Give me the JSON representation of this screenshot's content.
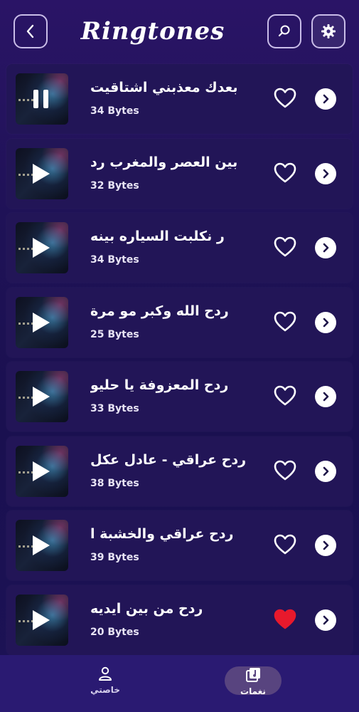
{
  "header": {
    "title": "Ringtones",
    "back_icon": "chevron-left-icon",
    "search_icon": "search-icon",
    "settings_icon": "gear-icon"
  },
  "ringtones": [
    {
      "name": "بعدك معذبني اشتاقيت",
      "size": "34 Bytes",
      "state": "pause",
      "favorite": false
    },
    {
      "name": "بين العصر والمغرب رد",
      "size": "32 Bytes",
      "state": "play",
      "favorite": false
    },
    {
      "name": "ر نكلبت السياره بينه",
      "size": "34 Bytes",
      "state": "play",
      "favorite": false
    },
    {
      "name": "ردح الله وكبر مو مرة",
      "size": "25 Bytes",
      "state": "play",
      "favorite": false
    },
    {
      "name": "ردح المعزوفة يا حليو",
      "size": "33 Bytes",
      "state": "play",
      "favorite": false
    },
    {
      "name": "ردح عراقي - عادل عكل",
      "size": "38 Bytes",
      "state": "play",
      "favorite": false
    },
    {
      "name": "ردح عراقي والخشبة ا",
      "size": "39 Bytes",
      "state": "play",
      "favorite": false
    },
    {
      "name": "ردح من بين ايديه",
      "size": "20 Bytes",
      "state": "play",
      "favorite": true
    }
  ],
  "bottom_nav": {
    "profile_label": "خاصتي",
    "tones_label": "نغمات",
    "active": "tones"
  },
  "colors": {
    "favorite_active": "#e8192c",
    "card_bg": "#221557",
    "nav_bg": "#2a1a72"
  }
}
